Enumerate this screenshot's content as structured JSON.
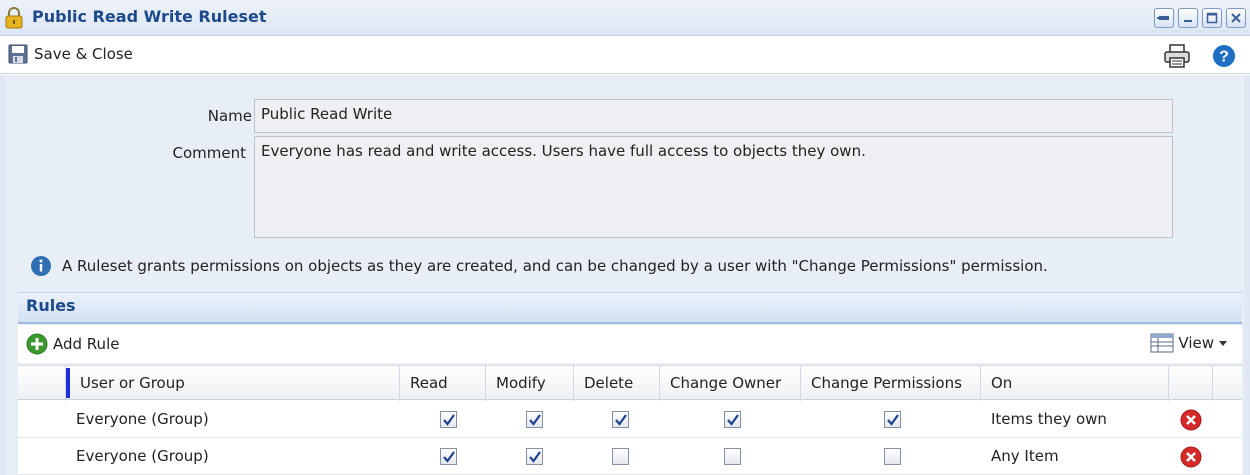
{
  "window": {
    "title": "Public Read Write Ruleset"
  },
  "toolbar": {
    "save_close_label": "Save & Close"
  },
  "form": {
    "name_label": "Name",
    "name_value": "Public Read Write",
    "comment_label": "Comment",
    "comment_value": "Everyone has read and write access. Users have full access to objects they own.",
    "info_text": "A Ruleset grants permissions on objects as they are created, and can be changed by a user with \"Change Permissions\" permission."
  },
  "rules": {
    "header": "Rules",
    "add_rule_label": "Add Rule",
    "view_label": "View",
    "columns": [
      "User or Group",
      "Read",
      "Modify",
      "Delete",
      "Change Owner",
      "Change Permissions",
      "On"
    ],
    "rows": [
      {
        "user": "Everyone (Group)",
        "read": true,
        "modify": true,
        "delete": true,
        "change_owner": true,
        "change_permissions": true,
        "on": "Items they own"
      },
      {
        "user": "Everyone (Group)",
        "read": true,
        "modify": true,
        "delete": false,
        "change_owner": false,
        "change_permissions": false,
        "on": "Any Item"
      }
    ]
  },
  "colors": {
    "title_text": "#1d4a8a",
    "header_accent": "#2030d8",
    "delete_red": "#d42a2a",
    "help_blue": "#1c6fc4",
    "add_green": "#3a9a2e"
  },
  "icons": [
    "lock-icon",
    "pin-icon",
    "minimize-icon",
    "maximize-icon",
    "close-icon",
    "save-icon",
    "print-icon",
    "help-icon",
    "info-icon",
    "add-icon",
    "view-grid-icon",
    "chevron-down-icon",
    "delete-icon",
    "checkbox-check-icon"
  ]
}
